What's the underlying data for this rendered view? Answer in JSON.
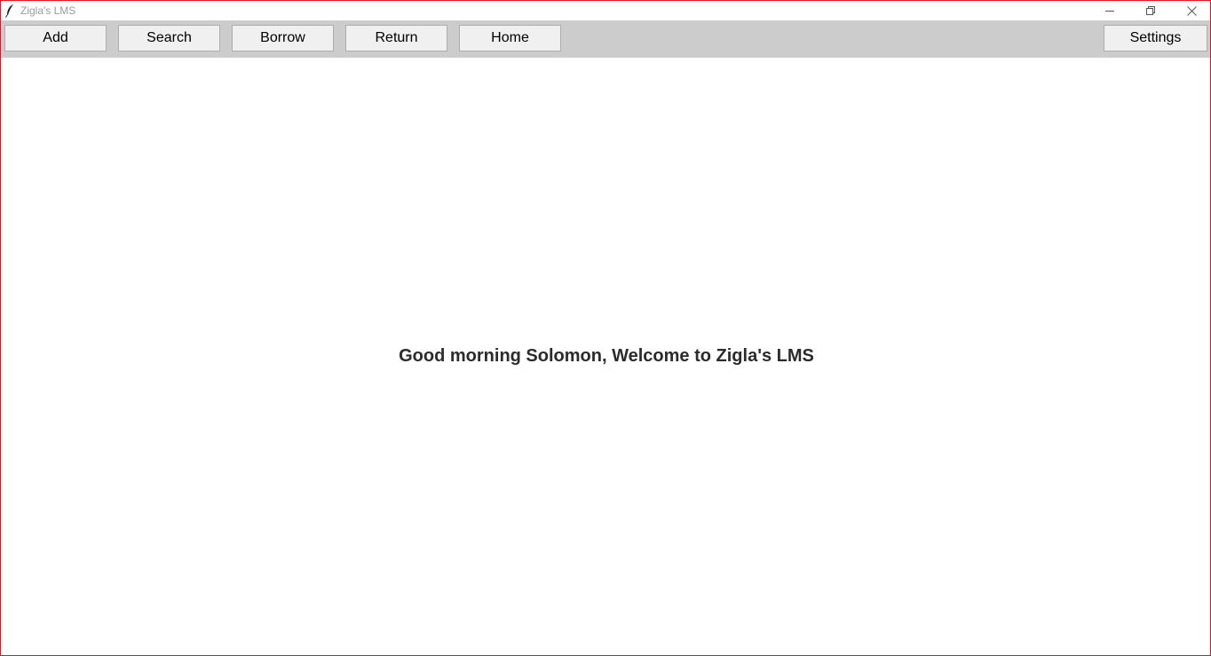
{
  "window": {
    "title": "Zigla's LMS",
    "border_color": "#e81123"
  },
  "toolbar": {
    "buttons": [
      {
        "label": "Add"
      },
      {
        "label": "Search"
      },
      {
        "label": "Borrow"
      },
      {
        "label": "Return"
      },
      {
        "label": "Home"
      }
    ],
    "settings_label": "Settings",
    "background_color": "#cccccc"
  },
  "main": {
    "greeting": "Good morning Solomon, Welcome to Zigla's LMS"
  }
}
